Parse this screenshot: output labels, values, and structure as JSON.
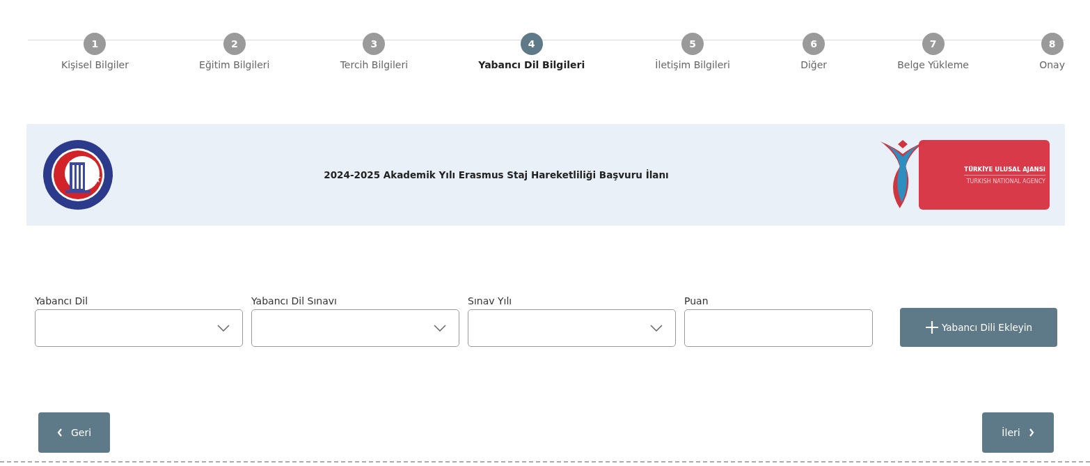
{
  "steps": [
    {
      "number": "1",
      "label": "Kişisel Bilgiler",
      "selected": false
    },
    {
      "number": "2",
      "label": "Eğitim Bilgileri",
      "selected": false
    },
    {
      "number": "3",
      "label": "Tercih Bilgileri",
      "selected": false
    },
    {
      "number": "4",
      "label": "Yabancı Dil Bilgileri",
      "selected": true
    },
    {
      "number": "5",
      "label": "İletişim Bilgileri",
      "selected": false
    },
    {
      "number": "6",
      "label": "Diğer",
      "selected": false
    },
    {
      "number": "7",
      "label": "Belge Yükleme",
      "selected": false
    },
    {
      "number": "8",
      "label": "Onay",
      "selected": false
    }
  ],
  "banner": {
    "title": "2024-2025 Akademik Yılı Erasmus Staj Hareketliliği Başvuru İlanı",
    "agency_logo": {
      "line_1": "TÜRKİYE ULUSAL AJANSI",
      "line_2": "TURKISH NATIONAL AGENCY"
    }
  },
  "fields": [
    {
      "label": "Yabancı Dil",
      "kind": "select"
    },
    {
      "label": "Yabancı Dil Sınavı",
      "kind": "select"
    },
    {
      "label": "Sınav Yılı",
      "kind": "select"
    },
    {
      "label": "Puan",
      "kind": "text"
    }
  ],
  "add_button": {
    "label": "Yabancı Dili Ekleyin"
  },
  "back_button": {
    "label": "Geri"
  },
  "next_button": {
    "label": "İleri"
  }
}
